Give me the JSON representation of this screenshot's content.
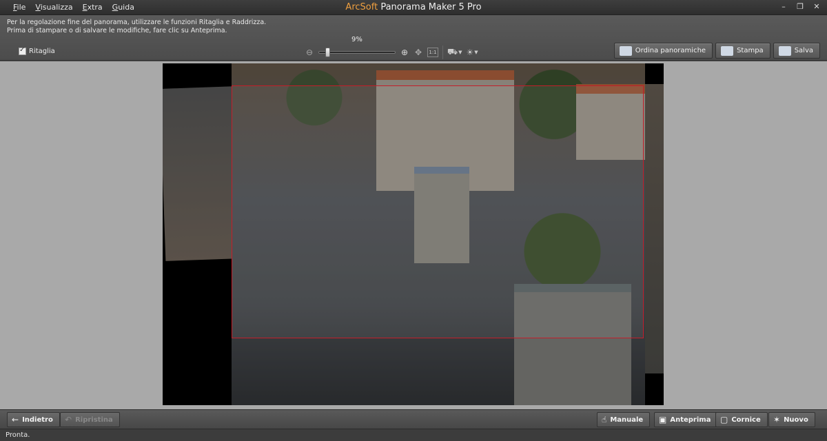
{
  "app": {
    "title_brand": "ArcSoft",
    "title_rest": " Panorama Maker 5 Pro"
  },
  "menu": [
    "File",
    "Visualizza",
    "Extra",
    "Guida"
  ],
  "window_controls": [
    "minimize-icon",
    "restore-icon",
    "close-icon"
  ],
  "hint": {
    "line1": "Per la regolazione fine del panorama, utilizzare le funzioni Ritaglia e Raddrizza.",
    "line2": "Prima di stampare o di salvare le modifiche, fare clic su Anteprima."
  },
  "crop_checkbox": {
    "label": "Ritaglia",
    "checked": true
  },
  "zoom": {
    "label": "9%",
    "value": 0.09,
    "fit_label": "1:1"
  },
  "top_buttons": {
    "arrange": "Ordina panoramiche",
    "print": "Stampa",
    "save": "Salva"
  },
  "bottom_buttons": {
    "back": "Indietro",
    "restore": "Ripristina",
    "manual": "Manuale",
    "preview": "Anteprima",
    "frame": "Cornice",
    "new": "Nuovo"
  },
  "status": "Pronta.",
  "colors": {
    "accent": "#f0a040",
    "crop_rect": "#c41e2a",
    "canvas_bg": "#a9a9a9"
  }
}
